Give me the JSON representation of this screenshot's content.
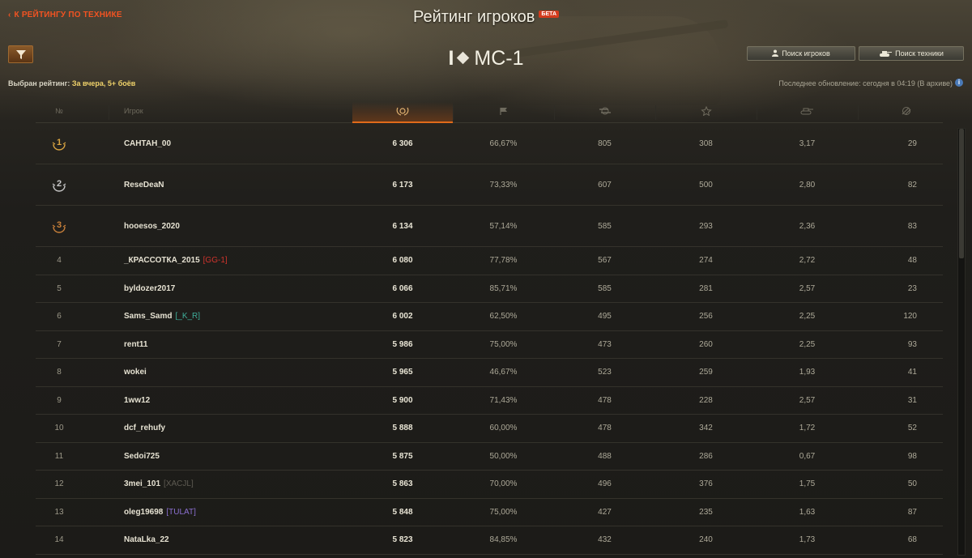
{
  "nav": {
    "back_label": "К РЕЙТИНГУ ПО ТЕХНИКЕ"
  },
  "header": {
    "title": "Рейтинг игроков",
    "badge": "БЕТА"
  },
  "vehicle": {
    "tier": "I",
    "name": "МС-1"
  },
  "buttons": {
    "search_players": "Поиск игроков",
    "search_vehicles": "Поиск техники"
  },
  "rating_info": {
    "label": "Выбран рейтинг:",
    "value": "За вчера, 5+ боёв"
  },
  "update_info": {
    "text": "Последнее обновление: сегодня в 04:19 (В архиве)"
  },
  "table": {
    "columns": {
      "rank": "№",
      "player": "Игрок"
    },
    "rows": [
      {
        "rank": "1",
        "name": "САНТАН_00",
        "clan": "",
        "clan_color": "",
        "score": "6 306",
        "win": "66,67%",
        "dmg": "805",
        "xp": "308",
        "frags": "3,17",
        "spot": "29"
      },
      {
        "rank": "2",
        "name": "ReseDeaN",
        "clan": "",
        "clan_color": "",
        "score": "6 173",
        "win": "73,33%",
        "dmg": "607",
        "xp": "500",
        "frags": "2,80",
        "spot": "82"
      },
      {
        "rank": "3",
        "name": "hooesos_2020",
        "clan": "",
        "clan_color": "",
        "score": "6 134",
        "win": "57,14%",
        "dmg": "585",
        "xp": "293",
        "frags": "2,36",
        "spot": "83"
      },
      {
        "rank": "4",
        "name": "_КРАССОТКА_2015",
        "clan": "[GG-1]",
        "clan_color": "#d0342c",
        "score": "6 080",
        "win": "77,78%",
        "dmg": "567",
        "xp": "274",
        "frags": "2,72",
        "spot": "48"
      },
      {
        "rank": "5",
        "name": "byldozer2017",
        "clan": "",
        "clan_color": "",
        "score": "6 066",
        "win": "85,71%",
        "dmg": "585",
        "xp": "281",
        "frags": "2,57",
        "spot": "23"
      },
      {
        "rank": "6",
        "name": "Sams_Samd",
        "clan": "[_K_R]",
        "clan_color": "#3fae9a",
        "score": "6 002",
        "win": "62,50%",
        "dmg": "495",
        "xp": "256",
        "frags": "2,25",
        "spot": "120"
      },
      {
        "rank": "7",
        "name": "rent11",
        "clan": "",
        "clan_color": "",
        "score": "5 986",
        "win": "75,00%",
        "dmg": "473",
        "xp": "260",
        "frags": "2,25",
        "spot": "93"
      },
      {
        "rank": "8",
        "name": "wokei",
        "clan": "",
        "clan_color": "",
        "score": "5 965",
        "win": "46,67%",
        "dmg": "523",
        "xp": "259",
        "frags": "1,93",
        "spot": "41"
      },
      {
        "rank": "9",
        "name": "1ww12",
        "clan": "",
        "clan_color": "",
        "score": "5 900",
        "win": "71,43%",
        "dmg": "478",
        "xp": "228",
        "frags": "2,57",
        "spot": "31"
      },
      {
        "rank": "10",
        "name": "dcf_rehufy",
        "clan": "",
        "clan_color": "",
        "score": "5 888",
        "win": "60,00%",
        "dmg": "478",
        "xp": "342",
        "frags": "1,72",
        "spot": "52"
      },
      {
        "rank": "11",
        "name": "Sedoi725",
        "clan": "",
        "clan_color": "",
        "score": "5 875",
        "win": "50,00%",
        "dmg": "488",
        "xp": "286",
        "frags": "0,67",
        "spot": "98"
      },
      {
        "rank": "12",
        "name": "3mei_101",
        "clan": "[XACJL]",
        "clan_color": "#5e5b52",
        "score": "5 863",
        "win": "70,00%",
        "dmg": "496",
        "xp": "376",
        "frags": "1,75",
        "spot": "50"
      },
      {
        "rank": "13",
        "name": "oleg19698",
        "clan": "[TULAT]",
        "clan_color": "#8a6fcf",
        "score": "5 848",
        "win": "75,00%",
        "dmg": "427",
        "xp": "235",
        "frags": "1,63",
        "spot": "87"
      },
      {
        "rank": "14",
        "name": "NataLka_22",
        "clan": "",
        "clan_color": "",
        "score": "5 823",
        "win": "84,85%",
        "dmg": "432",
        "xp": "240",
        "frags": "1,73",
        "spot": "68"
      }
    ]
  },
  "colors": {
    "accent": "#f25322",
    "rating_value": "#f0d26a",
    "gold": "#d9a441",
    "silver": "#c8c8c8",
    "bronze": "#c9803a"
  },
  "icons": {
    "header_score": "laurel-wreath-icon",
    "header_wins": "flag-icon",
    "header_damage": "damage-icon",
    "header_xp": "star-icon",
    "header_frags": "tank-destroyed-icon",
    "header_spot": "spot-icon"
  }
}
